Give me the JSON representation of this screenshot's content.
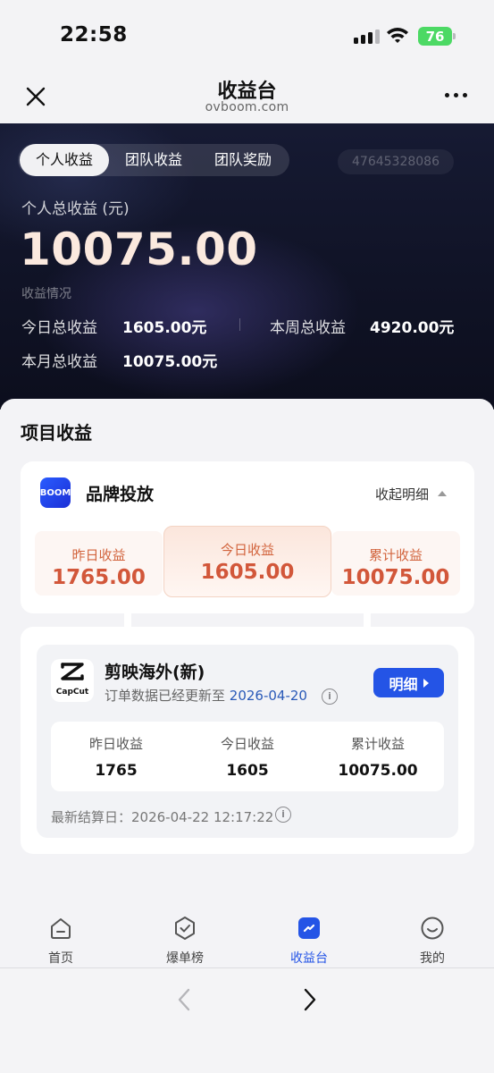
{
  "status_bar": {
    "time": "22:58",
    "battery": "76"
  },
  "nav": {
    "title": "收益台",
    "subtitle": "ovboom.com",
    "close_icon": "close-icon",
    "more_icon": "more-icon"
  },
  "hero": {
    "tabs": [
      "个人收益",
      "团队收益",
      "团队奖励"
    ],
    "active_tab": 0,
    "user_id": "47645328086",
    "total_label": "个人总收益 (元)",
    "total_value": "10075.00",
    "summary_label": "收益情况",
    "stats": {
      "today_label": "今日总收益",
      "today_value": "1605.00元",
      "week_label": "本周总收益",
      "week_value": "4920.00元",
      "month_label": "本月总收益",
      "month_value": "10075.00元"
    }
  },
  "project_section": {
    "title": "项目收益",
    "brand": {
      "logo_text": "BOOM",
      "name": "品牌投放",
      "collapse_label": "收起明细",
      "tiles": [
        {
          "label": "昨日收益",
          "value": "1765.00"
        },
        {
          "label": "今日收益",
          "value": "1605.00"
        },
        {
          "label": "累计收益",
          "value": "10075.00"
        }
      ]
    },
    "project": {
      "logo_text": "CapCut",
      "name": "剪映海外(新)",
      "update_prefix": "订单数据已经更新至",
      "update_date": "2026-04-20",
      "detail_button": "明细",
      "stats": [
        {
          "label": "昨日收益",
          "value": "1765"
        },
        {
          "label": "今日收益",
          "value": "1605"
        },
        {
          "label": "累计收益",
          "value": "10075.00"
        }
      ],
      "settle_label": "最新结算日：2026-04-22 12:17:22"
    }
  },
  "tabbar": {
    "items": [
      {
        "label": "首页",
        "icon": "home-icon"
      },
      {
        "label": "爆单榜",
        "icon": "check-badge-icon"
      },
      {
        "label": "收益台",
        "icon": "chart-icon"
      },
      {
        "label": "我的",
        "icon": "smile-icon"
      }
    ],
    "active": 2,
    "active_color": "#2454e6"
  },
  "browser": {
    "back_icon": "chevron-left-icon",
    "forward_icon": "chevron-right-icon"
  }
}
